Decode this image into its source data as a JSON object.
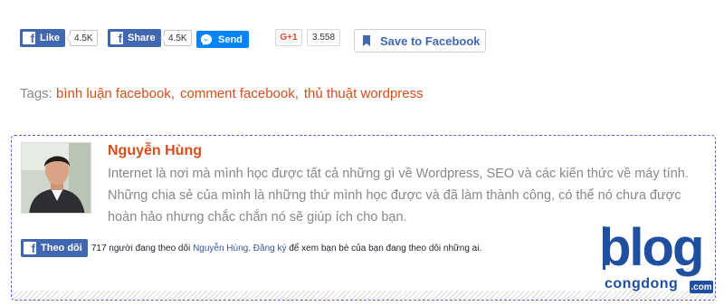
{
  "share_bar": {
    "like_label": "Like",
    "like_count": "4.5K",
    "share_label": "Share",
    "share_count": "4.5K",
    "send_label": "Send",
    "gplus_label": "G+1",
    "gplus_count": "3.558",
    "save_label": "Save to Facebook",
    "facebook_color": "#4267b2",
    "messenger_color": "#0084ff",
    "gplus_color": "#dd4b39"
  },
  "tags": {
    "label": "Tags:",
    "items": [
      "bình luận facebook",
      "comment facebook",
      "thủ thuật wordpress"
    ],
    "separator": ",",
    "link_color": "#d74e1b"
  },
  "author": {
    "name": "Nguyễn Hùng",
    "bio": "Internet là nơi mà mình học được tất cả những gì về Wordpress, SEO và các kiến thức về máy tính. Những chia sẻ của mình là những thứ mình học được và đã làm thành công, có thể nó chưa được hoàn hảo nhưng chắc chắn nó sẽ giúp ích cho bạn.",
    "follow_label": "Theo dõi",
    "follow_text_before": "717 người đang theo dõi ",
    "follow_link_name": "Nguyễn Hùng",
    "follow_link_register": "Đăng ký",
    "follow_text_after": " để xem bạn bè của bạn đang theo dõi những ai."
  },
  "logo": {
    "word": "blog",
    "subword": "congdong",
    "tld": ".com",
    "color": "#1f4fa0"
  }
}
